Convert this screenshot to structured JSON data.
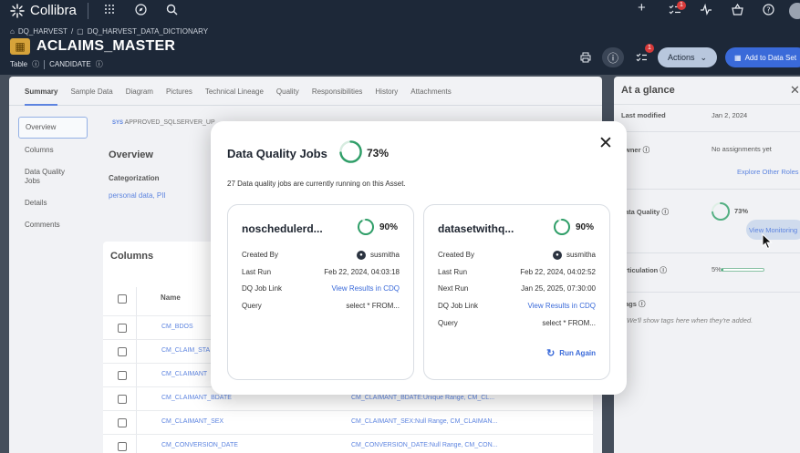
{
  "app": {
    "name": "Collibra"
  },
  "topbar": {
    "tasks_badge": "1"
  },
  "breadcrumb": [
    "DQ_HARVEST",
    "DQ_HARVEST_DATA_DICTIONARY"
  ],
  "breadcrumb_sep": "/",
  "asset": {
    "title": "ACLAIMS_MASTER",
    "type": "Table",
    "status": "CANDIDATE"
  },
  "header_actions": {
    "tasks_badge": "1",
    "actions_label": "Actions",
    "add_label": "Add to Data Set"
  },
  "tabs": [
    "Summary",
    "Sample Data",
    "Diagram",
    "Pictures",
    "Technical Lineage",
    "Quality",
    "Responsibilities",
    "History",
    "Attachments"
  ],
  "leftnav": [
    "Overview",
    "Columns",
    "Data Quality Jobs",
    "Details",
    "Comments"
  ],
  "sys_line": {
    "tag": "SYS",
    "text": "APPROVED_SQLSERVER_UP"
  },
  "overview": {
    "title": "Overview",
    "categorization_label": "Categorization",
    "categorization_value": "personal data, PII"
  },
  "columns": {
    "title": "Columns",
    "name_header": "Name",
    "rows": [
      {
        "name": "CM_BDOS",
        "rules": ""
      },
      {
        "name": "CM_CLAIM_STA",
        "rules": ""
      },
      {
        "name": "CM_CLAIMANT",
        "rules": ""
      },
      {
        "name": "CM_CLAIMANT_BDATE",
        "rules": "CM_CLAIMANT_BDATE:Unique Range, CM_CL..."
      },
      {
        "name": "CM_CLAIMANT_SEX",
        "rules": "CM_CLAIMANT_SEX:Null Range, CM_CLAIMAN..."
      },
      {
        "name": "CM_CONVERSION_DATE",
        "rules": "CM_CONVERSION_DATE:Null Range, CM_CON..."
      }
    ]
  },
  "at_a_glance": {
    "title": "At a glance",
    "last_modified_label": "Last modified",
    "last_modified_value": "Jan 2, 2024",
    "owner_label": "wner",
    "owner_value": "No assignments yet",
    "explore_link": "Explore Other Roles",
    "dq_label": "ata Quality",
    "dq_value": "73%",
    "dq_fraction": 0.73,
    "view_monitoring": "View Monitoring",
    "articulation_label": "rticulation",
    "articulation_value": "5%",
    "articulation_fraction": 0.05,
    "tags_label": "ags",
    "tags_empty": "We'll show tags here when they're added."
  },
  "modal": {
    "title": "Data Quality Jobs",
    "percent": "73%",
    "fraction": 0.73,
    "description": "27 Data quality jobs are currently running on this Asset.",
    "jobs": [
      {
        "name": "noschedulerd...",
        "percent": "90%",
        "fraction": 0.9,
        "fields": [
          {
            "label": "Created By",
            "value": "susmitha",
            "kind": "user"
          },
          {
            "label": "Last Run",
            "value": "Feb 22, 2024, 04:03:18",
            "kind": "text"
          },
          {
            "label": "DQ Job Link",
            "value": "View Results in CDQ",
            "kind": "link"
          },
          {
            "label": "Query",
            "value": "select * FROM...",
            "kind": "text"
          }
        ],
        "run_again": ""
      },
      {
        "name": "datasetwithq...",
        "percent": "90%",
        "fraction": 0.9,
        "fields": [
          {
            "label": "Created By",
            "value": "susmitha",
            "kind": "user"
          },
          {
            "label": "Last Run",
            "value": "Feb 22, 2024, 04:02:52",
            "kind": "text"
          },
          {
            "label": "Next Run",
            "value": "Jan 25, 2025, 07:30:00",
            "kind": "text"
          },
          {
            "label": "DQ Job Link",
            "value": "View Results in CDQ",
            "kind": "link"
          },
          {
            "label": "Query",
            "value": "select * FROM...",
            "kind": "text"
          }
        ],
        "run_again": "Run Again"
      }
    ]
  },
  "colors": {
    "accent": "#3a6ad9",
    "ring": "#2f9e68",
    "ring_track": "#d7ece0",
    "header_bg": "#1d2838"
  }
}
